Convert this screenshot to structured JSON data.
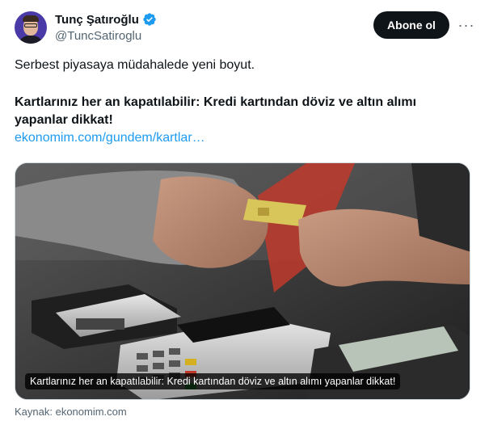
{
  "author": {
    "display_name": "Tunç Şatıroğlu",
    "handle": "@TuncSatiroglu",
    "verified": true,
    "verified_color": "#1d9bf0"
  },
  "actions": {
    "follow_label": "Abone ol",
    "more_label": "···"
  },
  "tweet": {
    "text_line": "Serbest piyasaya müdahalede yeni boyut.",
    "headline": "Kartlarınız her an kapatılabilir: Kredi kartından döviz ve altın alımı yapanlar dikkat!",
    "link_text": "ekonomim.com/gundem/kartlar…",
    "link_color": "#1d9bf0"
  },
  "media": {
    "caption": "Kartlarınız her an kapatılabilir: Kredi kartından döviz ve altın alımı yapanlar dikkat!"
  },
  "source": {
    "label": "Kaynak: ekonomim.com"
  }
}
